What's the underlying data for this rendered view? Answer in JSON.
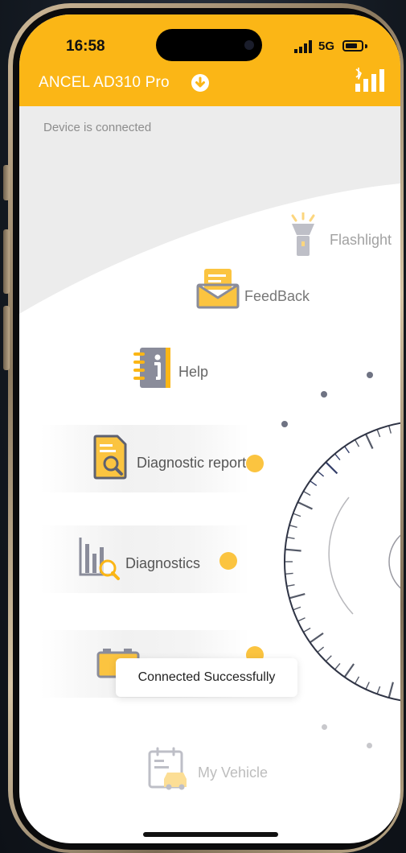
{
  "status_bar": {
    "time": "16:58",
    "network": "5G"
  },
  "header": {
    "title": "ANCEL AD310 Pro",
    "download_icon": "download-circle-icon",
    "connection_icon": "bluetooth-signal-icon"
  },
  "device_status": "Device is connected",
  "menu": {
    "items": [
      {
        "label": "Flashlight",
        "icon": "flashlight-icon"
      },
      {
        "label": "FeedBack",
        "icon": "envelope-icon"
      },
      {
        "label": "Help",
        "icon": "help-book-icon"
      },
      {
        "label": "Diagnostic report",
        "icon": "report-search-icon"
      },
      {
        "label": "Diagnostics",
        "icon": "chart-search-icon"
      },
      {
        "label": "",
        "icon": "battery-icon"
      },
      {
        "label": "My Vehicle",
        "icon": "vehicle-calendar-icon"
      }
    ]
  },
  "toast": "Connected Successfully",
  "colors": {
    "accent": "#fbb616",
    "icon_grey": "#8a8c9a",
    "dot_grey": "#6f7383"
  }
}
